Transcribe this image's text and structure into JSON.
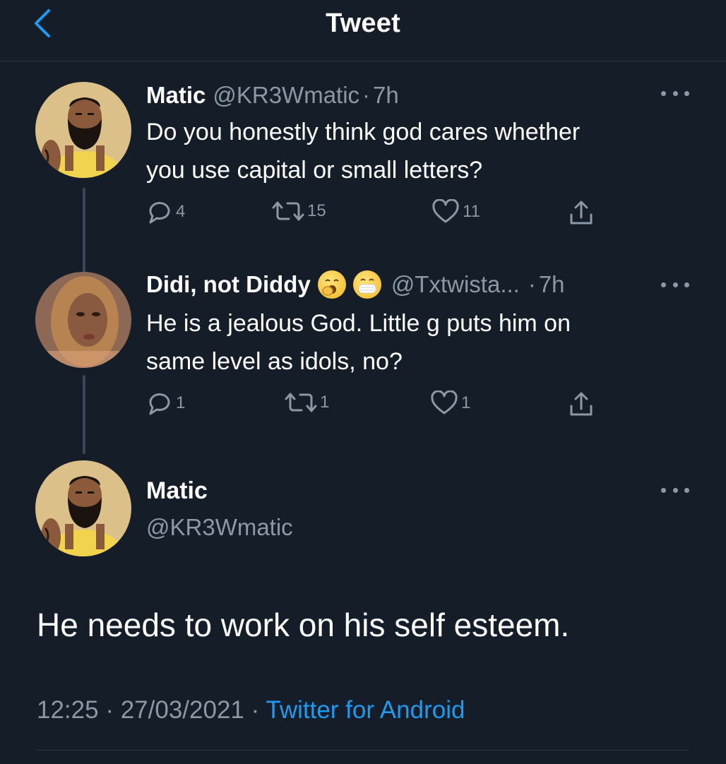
{
  "header": {
    "title": "Tweet"
  },
  "tweets": [
    {
      "name": "Matic",
      "handle": "@KR3Wmatic",
      "dot": "·",
      "time": "7h",
      "text_lines": [
        "Do you honestly think god cares whether",
        "you use capital or small letters?"
      ],
      "replies": "4",
      "retweets": "15",
      "likes": "11"
    },
    {
      "name": "Didi, not Diddy",
      "handle": "@Txtwista...",
      "dot": "·",
      "time": "7h",
      "text_lines": [
        "He is a jealous God. Little g puts him on",
        "same level as idols, no?"
      ],
      "replies": "1",
      "retweets": "1",
      "likes": "1"
    }
  ],
  "main_tweet": {
    "name": "Matic",
    "handle": "@KR3Wmatic",
    "text": "He needs to work on his self esteem.",
    "time": "12:25",
    "sep1": "·",
    "date": "27/03/2021",
    "sep2": "·",
    "source": "Twitter for Android"
  },
  "colors": {
    "background": "#151d29",
    "muted": "#8b98a5",
    "link": "#1d9bf0",
    "divider": "#2b3746"
  },
  "icons": [
    "chevron-left-icon",
    "more-icon",
    "reply-icon",
    "retweet-icon",
    "like-icon",
    "share-icon",
    "yawning-face-emoji",
    "mask-face-emoji"
  ]
}
